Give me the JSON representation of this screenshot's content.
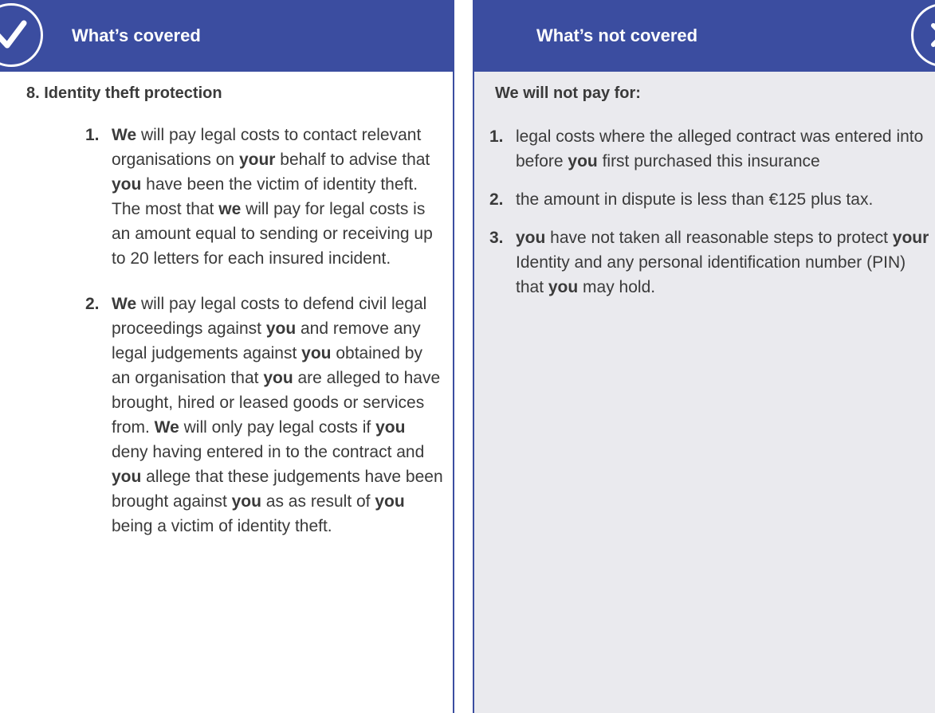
{
  "covered": {
    "header": "What’s covered",
    "section_title": "8. Identity theft protection",
    "items": [
      {
        "num": "1.",
        "parts": [
          {
            "t": "We",
            "b": true
          },
          {
            "t": " will pay legal costs to contact relevant organisations on ",
            "b": false
          },
          {
            "t": "your",
            "b": true
          },
          {
            "t": " behalf to advise that ",
            "b": false
          },
          {
            "t": "you",
            "b": true
          },
          {
            "t": " have been the victim of identity theft. The most that ",
            "b": false
          },
          {
            "t": "we",
            "b": true
          },
          {
            "t": " will pay for legal costs is an amount equal to sending or receiving up to 20 letters for each insured incident.",
            "b": false
          }
        ]
      },
      {
        "num": "2.",
        "parts": [
          {
            "t": "We",
            "b": true
          },
          {
            "t": " will pay legal costs to defend civil legal proceedings against ",
            "b": false
          },
          {
            "t": "you",
            "b": true
          },
          {
            "t": " and remove any legal judgements against ",
            "b": false
          },
          {
            "t": "you",
            "b": true
          },
          {
            "t": " obtained by an organisation that ",
            "b": false
          },
          {
            "t": "you",
            "b": true
          },
          {
            "t": " are alleged to have brought, hired or leased goods or services from. ",
            "b": false
          },
          {
            "t": "We",
            "b": true
          },
          {
            "t": " will only pay legal costs if ",
            "b": false
          },
          {
            "t": "you",
            "b": true
          },
          {
            "t": " deny having entered in to the contract and ",
            "b": false
          },
          {
            "t": "you",
            "b": true
          },
          {
            "t": " allege that these judgements have been brought against ",
            "b": false
          },
          {
            "t": "you",
            "b": true
          },
          {
            "t": " as as result of ",
            "b": false
          },
          {
            "t": "you",
            "b": true
          },
          {
            "t": " being a victim of identity theft.",
            "b": false
          }
        ]
      }
    ]
  },
  "not_covered": {
    "header": "What’s not covered",
    "section_title": "We will not pay for:",
    "items": [
      {
        "num": "1.",
        "parts": [
          {
            "t": "legal costs where the alleged contract was entered into before ",
            "b": false
          },
          {
            "t": "you",
            "b": true
          },
          {
            "t": " first purchased this insurance",
            "b": false
          }
        ]
      },
      {
        "num": "2.",
        "parts": [
          {
            "t": "the amount in dispute is less than €125 plus tax.",
            "b": false
          }
        ]
      },
      {
        "num": "3.",
        "parts": [
          {
            "t": "you",
            "b": true
          },
          {
            "t": " have not taken all reasonable steps to protect ",
            "b": false
          },
          {
            "t": "your",
            "b": true
          },
          {
            "t": " Identity and any personal identification number (PIN) that ",
            "b": false
          },
          {
            "t": "you",
            "b": true
          },
          {
            "t": " may hold.",
            "b": false
          }
        ]
      }
    ]
  },
  "icons": {
    "covered": "check-icon",
    "not_covered": "cross-icon"
  },
  "colors": {
    "header_bg": "#3b4da0",
    "right_panel_bg": "#eaeaee",
    "text": "#3a3a3a"
  }
}
